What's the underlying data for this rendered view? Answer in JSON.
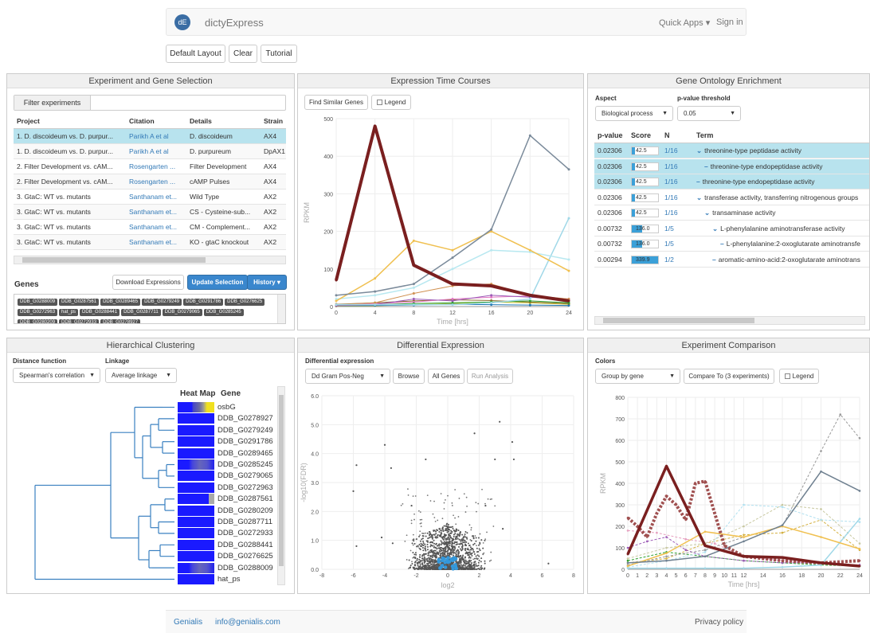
{
  "navbar": {
    "logo": "dE",
    "brand": "dictyExpress",
    "quick_apps": "Quick Apps ▾",
    "sign_in": "Sign in"
  },
  "toolbar": {
    "default_layout": "Default Layout",
    "clear": "Clear",
    "tutorial": "Tutorial"
  },
  "exp_panel": {
    "title": "Experiment and Gene Selection",
    "filter_label": "Filter experiments",
    "columns": [
      "Project",
      "Citation",
      "Details",
      "Strain"
    ],
    "rows": [
      {
        "project": "1. D. discoideum vs. D. purpur...",
        "citation": "Parikh A et al",
        "details": "D. discoideum",
        "strain": "AX4",
        "selected": true
      },
      {
        "project": "1. D. discoideum vs. D. purpur...",
        "citation": "Parikh A et al",
        "details": "D. purpureum",
        "strain": "DpAX1",
        "selected": false
      },
      {
        "project": "2. Filter Development vs. cAM...",
        "citation": "Rosengarten ...",
        "details": "Filter Development",
        "strain": "AX4",
        "selected": false
      },
      {
        "project": "2. Filter Development vs. cAM...",
        "citation": "Rosengarten ...",
        "details": "cAMP Pulses",
        "strain": "AX4",
        "selected": false
      },
      {
        "project": "3. GtaC: WT vs. mutants",
        "citation": "Santhanam et...",
        "details": "Wild Type",
        "strain": "AX2",
        "selected": false
      },
      {
        "project": "3. GtaC: WT vs. mutants",
        "citation": "Santhanam et...",
        "details": "CS - Cysteine-sub...",
        "strain": "AX2",
        "selected": false
      },
      {
        "project": "3. GtaC: WT vs. mutants",
        "citation": "Santhanam et...",
        "details": "CM - Complement...",
        "strain": "AX2",
        "selected": false
      },
      {
        "project": "3. GtaC: WT vs. mutants",
        "citation": "Santhanam et...",
        "details": "KO - gtaC knockout",
        "strain": "AX2",
        "selected": false
      }
    ],
    "genes_label": "Genes",
    "download_expressions": "Download Expressions",
    "update_selection": "Update Selection",
    "history": "History",
    "gene_tags": [
      "DDB_G0288009",
      "DDB_G0287561",
      "DDB_G0289465",
      "DDB_G0279249",
      "DDB_G0291786",
      "DDB_G0276625",
      "DDB_G0272963",
      "hat_ps",
      "DDB_G0288441",
      "DDB_G0287711",
      "DDB_G0279065",
      "DDB_G0285245",
      "DDB_G0280209",
      "DDB_G0272933",
      "DDB_G0278927"
    ]
  },
  "etc_panel": {
    "title": "Expression Time Courses",
    "find_similar": "Find Similar Genes",
    "legend": "Legend",
    "chart_data": {
      "type": "line",
      "xlabel": "Time [hrs]",
      "ylabel": "RPKM",
      "x": [
        0,
        4,
        8,
        12,
        16,
        20,
        24
      ],
      "xticks": [
        "0",
        "4",
        "8",
        "12",
        "16",
        "20",
        "24"
      ],
      "yticks": [
        "0",
        "100",
        "200",
        "300",
        "400",
        "500"
      ],
      "ylim": [
        0,
        500
      ],
      "series": [
        {
          "color": "#7a1f1f",
          "width": 4,
          "values": [
            70,
            480,
            110,
            60,
            55,
            30,
            15
          ]
        },
        {
          "color": "#7a8a9a",
          "width": 1.5,
          "values": [
            30,
            40,
            60,
            130,
            205,
            455,
            365
          ]
        },
        {
          "color": "#f0c050",
          "width": 1.5,
          "values": [
            15,
            75,
            175,
            150,
            200,
            150,
            95
          ]
        },
        {
          "color": "#b8e8f0",
          "width": 1.5,
          "values": [
            20,
            30,
            50,
            100,
            150,
            145,
            125
          ]
        },
        {
          "color": "#a0d8e8",
          "width": 1.5,
          "values": [
            5,
            5,
            5,
            5,
            10,
            20,
            235
          ]
        },
        {
          "color": "#d09050",
          "width": 1,
          "values": [
            5,
            10,
            35,
            55,
            60,
            30,
            20
          ]
        },
        {
          "color": "#9b59b6",
          "width": 1,
          "values": [
            2,
            5,
            20,
            15,
            30,
            25,
            18
          ]
        },
        {
          "color": "#2ca02c",
          "width": 1,
          "values": [
            3,
            5,
            8,
            10,
            12,
            15,
            10
          ]
        },
        {
          "color": "#e377c2",
          "width": 1,
          "values": [
            4,
            8,
            12,
            20,
            25,
            28,
            20
          ]
        },
        {
          "color": "#8c6d31",
          "width": 1,
          "values": [
            6,
            10,
            15,
            18,
            16,
            12,
            8
          ]
        },
        {
          "color": "#1f77b4",
          "width": 1,
          "values": [
            2,
            3,
            4,
            6,
            5,
            4,
            3
          ]
        },
        {
          "color": "#bcbd22",
          "width": 1,
          "values": [
            1,
            2,
            5,
            8,
            12,
            10,
            6
          ]
        }
      ]
    }
  },
  "go_panel": {
    "title": "Gene Ontology Enrichment",
    "aspect_label": "Aspect",
    "aspect_value": "Biological process",
    "pvalue_label": "p-value threshold",
    "pvalue_value": "0.05",
    "columns": [
      "p-value",
      "Score",
      "N",
      "Term"
    ],
    "rows": [
      {
        "p": "0.02306",
        "score": "42.5",
        "bar": 0.12,
        "n": "1/16",
        "indent": 0,
        "icon": "chevron",
        "term": "threonine-type peptidase activity",
        "sel": true
      },
      {
        "p": "0.02306",
        "score": "42.5",
        "bar": 0.12,
        "n": "1/16",
        "indent": 1,
        "icon": "dash",
        "term": "threonine-type endopeptidase activity",
        "sel": true
      },
      {
        "p": "0.02306",
        "score": "42.5",
        "bar": 0.12,
        "n": "1/16",
        "indent": 0,
        "icon": "dash",
        "term": "threonine-type endopeptidase activity",
        "sel": true
      },
      {
        "p": "0.02306",
        "score": "42.5",
        "bar": 0.12,
        "n": "1/16",
        "indent": 0,
        "icon": "chevron",
        "term": "transferase activity, transferring nitrogenous groups",
        "sel": false
      },
      {
        "p": "0.02306",
        "score": "42.5",
        "bar": 0.12,
        "n": "1/16",
        "indent": 1,
        "icon": "chevron",
        "term": "transaminase activity",
        "sel": false
      },
      {
        "p": "0.00732",
        "score": "136.0",
        "bar": 0.4,
        "n": "1/5",
        "indent": 2,
        "icon": "chevron",
        "term": "L-phenylalanine aminotransferase activity",
        "sel": false
      },
      {
        "p": "0.00732",
        "score": "136.0",
        "bar": 0.4,
        "n": "1/5",
        "indent": 3,
        "icon": "dash",
        "term": "L-phenylalanine:2-oxoglutarate aminotransfe",
        "sel": false
      },
      {
        "p": "0.00294",
        "score": "339.9",
        "bar": 1.0,
        "n": "1/2",
        "indent": 2,
        "icon": "dash",
        "term": "aromatic-amino-acid:2-oxoglutarate aminotrans",
        "sel": false
      }
    ]
  },
  "hc_panel": {
    "title": "Hierarchical Clustering",
    "distance_label": "Distance function",
    "distance_value": "Spearman's correlation",
    "linkage_label": "Linkage",
    "linkage_value": "Average linkage",
    "heatmap_header": "Heat Map",
    "gene_header": "Gene",
    "genes": [
      "osbG",
      "DDB_G0278927",
      "DDB_G0279249",
      "DDB_G0291786",
      "DDB_G0289465",
      "DDB_G0285245",
      "DDB_G0279065",
      "DDB_G0272963",
      "DDB_G0287561",
      "DDB_G0280209",
      "DDB_G0287711",
      "DDB_G0272933",
      "DDB_G0288441",
      "DDB_G0276625",
      "DDB_G0288009",
      "hat_ps"
    ]
  },
  "de_panel": {
    "title": "Differential Expression",
    "label": "Differential expression",
    "select_value": "Dd Gram Pos-Neg",
    "browse": "Browse",
    "all_genes": "All Genes",
    "run_analysis": "Run Analysis",
    "chart_data": {
      "type": "scatter",
      "xlabel": "log2",
      "ylabel": "-log10(FDR)",
      "xticks": [
        "-8",
        "-6",
        "-4",
        "-2",
        "0",
        "2",
        "4",
        "6",
        "8"
      ],
      "yticks": [
        "0.0",
        "1.0",
        "2.0",
        "3.0",
        "4.0",
        "5.0",
        "6.0"
      ],
      "xlim": [
        -8,
        8
      ],
      "ylim": [
        0,
        6
      ],
      "outliers": [
        [
          -5.8,
          3.6
        ],
        [
          -4,
          4.3
        ],
        [
          -3.6,
          3.5
        ],
        [
          -1.4,
          3.8
        ],
        [
          3,
          3.8
        ],
        [
          3.3,
          5.1
        ],
        [
          4.1,
          4.4
        ],
        [
          4.2,
          3.8
        ],
        [
          1.7,
          4.7
        ],
        [
          -5.8,
          0.8
        ],
        [
          -4.2,
          1.1
        ],
        [
          -3.5,
          0.9
        ],
        [
          -2.3,
          2.2
        ],
        [
          2.4,
          2.2
        ],
        [
          3.5,
          1.4
        ],
        [
          6.4,
          0.2
        ],
        [
          -6,
          2.7
        ]
      ]
    }
  },
  "ec_panel": {
    "title": "Experiment Comparison",
    "colors_label": "Colors",
    "group_value": "Group by gene",
    "compare_to": "Compare To (3 experiments)",
    "legend": "Legend",
    "chart_data": {
      "type": "line",
      "xlabel": "Time [hrs]",
      "ylabel": "RPKM",
      "xticks": [
        "0",
        "1",
        "2",
        "3",
        "4",
        "5",
        "6",
        "7",
        "8",
        "9",
        "10",
        "11",
        "12",
        "14",
        "16",
        "18",
        "20",
        "22",
        "24"
      ],
      "yticks": [
        "0",
        "100",
        "200",
        "300",
        "400",
        "500",
        "600",
        "700",
        "800"
      ],
      "ylim": [
        0,
        800
      ],
      "series": [
        {
          "color": "#7a1f1f",
          "width": 3.5,
          "dash": "",
          "x": [
            0,
            4,
            8,
            12,
            16,
            20,
            24
          ],
          "values": [
            70,
            480,
            110,
            60,
            55,
            30,
            15
          ]
        },
        {
          "color": "#a05050",
          "width": 4,
          "dash": "3,2",
          "x": [
            0,
            1,
            2,
            3,
            4,
            5,
            6,
            7,
            8,
            10,
            12,
            16,
            20,
            24
          ],
          "values": [
            240,
            200,
            150,
            260,
            340,
            300,
            230,
            400,
            410,
            110,
            60,
            40,
            30,
            40
          ]
        },
        {
          "color": "#6f8090",
          "width": 1.5,
          "dash": "",
          "x": [
            0,
            4,
            8,
            12,
            16,
            20,
            24
          ],
          "values": [
            30,
            40,
            60,
            130,
            205,
            455,
            365
          ]
        },
        {
          "color": "#f0c050",
          "width": 1.5,
          "dash": "",
          "x": [
            0,
            4,
            8,
            12,
            16,
            20,
            24
          ],
          "values": [
            15,
            75,
            175,
            150,
            200,
            150,
            95
          ]
        },
        {
          "color": "#a0d8e8",
          "width": 1.5,
          "dash": "",
          "x": [
            0,
            4,
            8,
            12,
            16,
            20,
            24
          ],
          "values": [
            5,
            5,
            5,
            5,
            10,
            20,
            235
          ]
        },
        {
          "color": "#999999",
          "width": 1,
          "dash": "3,2",
          "x": [
            0,
            4,
            8,
            12,
            16,
            20,
            22,
            24
          ],
          "values": [
            20,
            60,
            90,
            150,
            200,
            550,
            720,
            610
          ]
        },
        {
          "color": "#c8c8a0",
          "width": 1,
          "dash": "3,2",
          "x": [
            0,
            4,
            8,
            12,
            16,
            20,
            24
          ],
          "values": [
            50,
            100,
            120,
            200,
            300,
            280,
            120
          ]
        },
        {
          "color": "#b0e0f0",
          "width": 1,
          "dash": "3,2",
          "x": [
            0,
            4,
            8,
            12,
            16,
            20,
            24
          ],
          "values": [
            10,
            40,
            80,
            300,
            290,
            230,
            220
          ]
        },
        {
          "color": "#9b59b6",
          "width": 1,
          "dash": "3,2",
          "x": [
            0,
            2,
            4,
            6,
            8,
            12,
            16,
            20,
            24
          ],
          "values": [
            100,
            130,
            150,
            90,
            60,
            40,
            30,
            30,
            20
          ]
        },
        {
          "color": "#2ca02c",
          "width": 1,
          "dash": "3,2",
          "x": [
            0,
            4,
            8,
            12,
            16,
            20,
            24
          ],
          "values": [
            40,
            80,
            60,
            40,
            30,
            20,
            15
          ]
        },
        {
          "color": "#e6a0c0",
          "width": 1,
          "dash": "3,2",
          "x": [
            0,
            3,
            6,
            9,
            12,
            16,
            20,
            24
          ],
          "values": [
            180,
            170,
            140,
            120,
            60,
            40,
            30,
            20
          ]
        },
        {
          "color": "#d4b040",
          "width": 1,
          "dash": "3,2",
          "x": [
            0,
            4,
            8,
            12,
            16,
            20,
            24
          ],
          "values": [
            30,
            50,
            120,
            160,
            170,
            230,
            90
          ]
        }
      ]
    }
  },
  "footer": {
    "company": "Genialis",
    "email": "info@genialis.com",
    "privacy": "Privacy policy"
  },
  "colors": {
    "selected_row": "#b8e3ee",
    "accent": "#337ab7",
    "primary_btn": "#3a87cd"
  }
}
